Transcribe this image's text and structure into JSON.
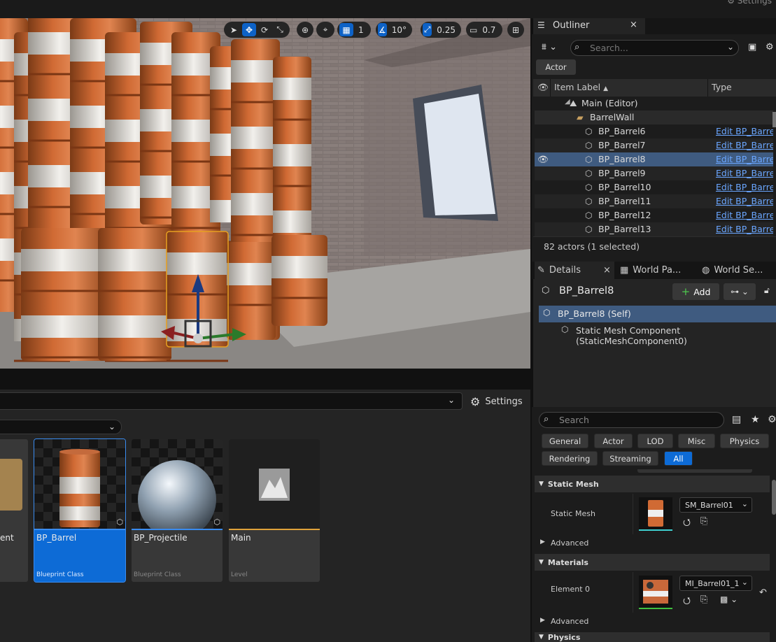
{
  "top": {
    "settings_label": "Settings"
  },
  "viewport_toolbar": {
    "grid_value": "1",
    "rotation_snap": "10°",
    "scale_snap": "0.25",
    "camera_speed": "0.7"
  },
  "outliner": {
    "tab_label": "Outliner",
    "search_placeholder": "Search...",
    "filter_chip": "Actor",
    "col_label": "Item Label",
    "col_type": "Type",
    "world_row": "Main (Editor)",
    "folder_row": "BarrelWall",
    "rows": [
      {
        "label": "BP_Barrel6",
        "type": "Edit BP_Barrel"
      },
      {
        "label": "BP_Barrel7",
        "type": "Edit BP_Barrel"
      },
      {
        "label": "BP_Barrel8",
        "type": "Edit BP_Barrel",
        "selected": true
      },
      {
        "label": "BP_Barrel9",
        "type": "Edit BP_Barrel"
      },
      {
        "label": "BP_Barrel10",
        "type": "Edit BP_Barrel"
      },
      {
        "label": "BP_Barrel11",
        "type": "Edit BP_Barrel"
      },
      {
        "label": "BP_Barrel12",
        "type": "Edit BP_Barrel"
      },
      {
        "label": "BP_Barrel13",
        "type": "Edit BP_Barrel"
      }
    ],
    "status": "82 actors (1 selected)"
  },
  "details": {
    "tabs": [
      "Details",
      "World Pa...",
      "World Se..."
    ],
    "actor_name": "BP_Barrel8",
    "add_label": "Add",
    "self_row": "BP_Barrel8 (Self)",
    "component_row": "Static Mesh Component (StaticMeshComponent0)",
    "search_placeholder": "Search",
    "filters_row1": [
      "General",
      "Actor",
      "LOD",
      "Misc",
      "Physics"
    ],
    "filters_row2": [
      "Rendering",
      "Streaming",
      "All"
    ],
    "section_static_mesh": "Static Mesh",
    "prop_static_mesh": "Static Mesh",
    "static_mesh_value": "SM_Barrel01",
    "advanced_1": "Advanced",
    "section_materials": "Materials",
    "prop_element0": "Element 0",
    "element0_value": "MI_Barrel01_1",
    "advanced_2": "Advanced",
    "section_physics": "Physics"
  },
  "content_browser": {
    "settings_label": "Settings",
    "partial_tile_text": "ent",
    "tiles": [
      {
        "name": "BP_Barrel",
        "class": "Blueprint Class"
      },
      {
        "name": "BP_Projectile",
        "class": "Blueprint Class"
      },
      {
        "name": "Main",
        "class": "Level"
      }
    ]
  },
  "colors": {
    "accent": "#0d6bd6",
    "selected_row": "#3f5b80",
    "link": "#6aa6ff",
    "level_bar": "#e0a23a"
  }
}
